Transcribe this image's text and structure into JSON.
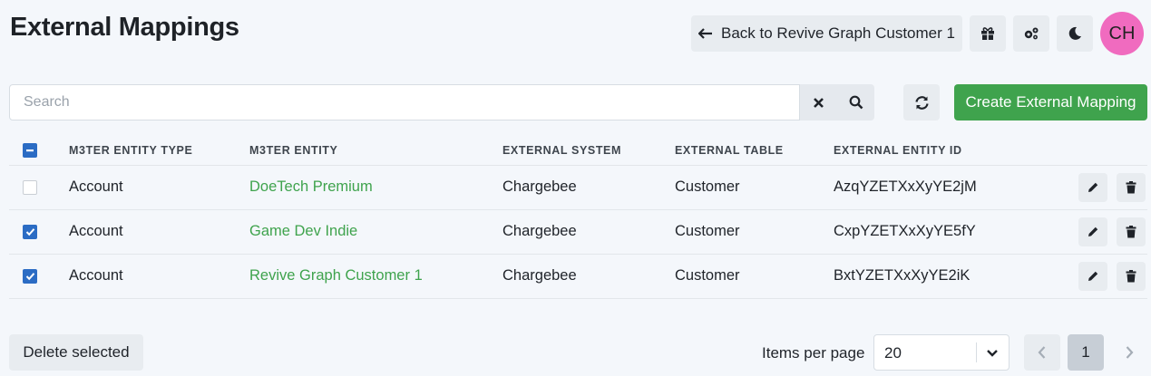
{
  "page": {
    "title": "External Mappings"
  },
  "header": {
    "back_label": "Back to Revive Graph Customer 1",
    "avatar_initials": "CH"
  },
  "search": {
    "placeholder": "Search",
    "value": ""
  },
  "toolbar": {
    "create_label": "Create External Mapping"
  },
  "table": {
    "columns": [
      "M3TER ENTITY TYPE",
      "M3TER ENTITY",
      "EXTERNAL SYSTEM",
      "EXTERNAL TABLE",
      "EXTERNAL ENTITY ID"
    ],
    "header_checkbox": "partial",
    "rows": [
      {
        "checked": false,
        "entity_type": "Account",
        "entity": "DoeTech Premium",
        "external_system": "Chargebee",
        "external_table": "Customer",
        "external_id": "AzqYZETXxXyYE2jM"
      },
      {
        "checked": true,
        "entity_type": "Account",
        "entity": "Game Dev Indie",
        "external_system": "Chargebee",
        "external_table": "Customer",
        "external_id": "CxpYZETXxXyYE5fY"
      },
      {
        "checked": true,
        "entity_type": "Account",
        "entity": "Revive Graph Customer 1",
        "external_system": "Chargebee",
        "external_table": "Customer",
        "external_id": "BxtYZETXxXyYE2iK"
      }
    ]
  },
  "footer": {
    "delete_label": "Delete selected",
    "items_per_page_label": "Items per page",
    "items_per_page_value": "20",
    "current_page": "1"
  },
  "colors": {
    "accent": "#3fa34d",
    "checkbox": "#2b6cc4",
    "avatar": "#f06bbf"
  },
  "icons": [
    "arrow-left-icon",
    "gift-icon",
    "cogs-icon",
    "moon-icon",
    "close-icon",
    "search-icon",
    "refresh-icon",
    "pencil-icon",
    "trash-icon",
    "chevron-down-icon",
    "chevron-left-icon",
    "chevron-right-icon"
  ]
}
